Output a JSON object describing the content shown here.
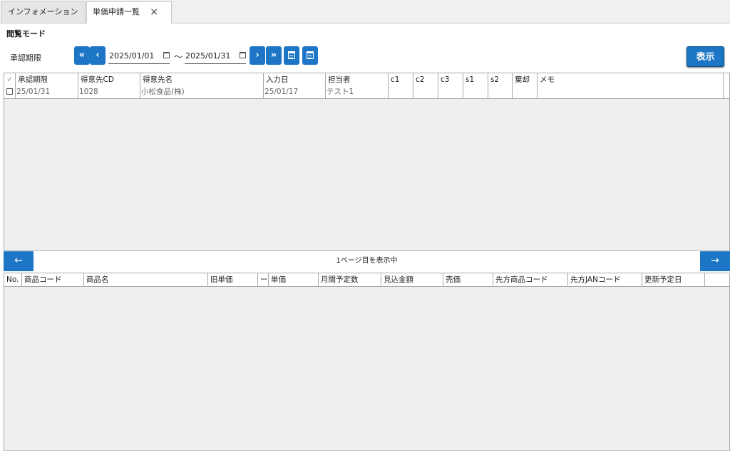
{
  "tabs": [
    {
      "label": "インフォメーション"
    },
    {
      "label": "単価申請一覧",
      "close": "×"
    }
  ],
  "mode_label": "閲覧モード",
  "filter": {
    "label": "承認期限",
    "first_btn": "«",
    "prev_btn": "‹",
    "from_date": "2025/01/01",
    "tilde": "～",
    "to_date": "2025/01/31",
    "next_btn": "›",
    "last_btn": "»",
    "display_btn": "表示"
  },
  "grid1": {
    "headers": [
      "✓",
      "承認期限",
      "得意先CD",
      "得意先名",
      "入力日",
      "担当者",
      "c1",
      "c2",
      "c3",
      "s1",
      "s2",
      "棄却",
      "メモ"
    ],
    "rows": [
      [
        "",
        "25/01/31",
        "1028",
        "小松食品(株)",
        "25/01/17",
        "テスト1",
        "",
        "",
        "",
        "",
        "",
        "",
        ""
      ]
    ]
  },
  "pager": {
    "prev": "←",
    "text": "1ページ目を表示中",
    "next": "→"
  },
  "grid2": {
    "headers": [
      "No.",
      "商品コード",
      "商品名",
      "旧単価",
      "ー",
      "単価",
      "月間予定数",
      "見込金額",
      "売価",
      "先方商品コード",
      "先方JANコード",
      "更新予定日"
    ]
  },
  "colors": {
    "accent": "#1c76c5",
    "grid_bg": "#efefef",
    "border": "#a9a9a9"
  }
}
